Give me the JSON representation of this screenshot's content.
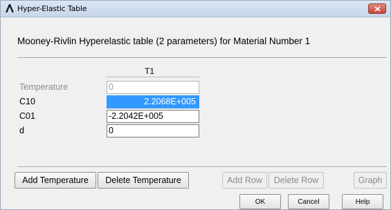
{
  "window": {
    "title": "Hyper-Elastic Table",
    "close_icon": "close-icon",
    "app_icon": "ansys-logo-icon"
  },
  "heading": "Mooney-Rivlin Hyperelastic table (2 parameters) for Material Number 1",
  "table": {
    "column_header": "T1",
    "rows": [
      {
        "label": "Temperature",
        "value": "0",
        "state": "disabled"
      },
      {
        "label": "C10",
        "value": "2.2068E+005",
        "state": "selected"
      },
      {
        "label": "C01",
        "value": "-2.2042E+005",
        "state": "normal"
      },
      {
        "label": "d",
        "value": "0",
        "state": "normal"
      }
    ]
  },
  "buttons": {
    "add_temperature": "Add Temperature",
    "delete_temperature": "Delete Temperature",
    "add_row": "Add Row",
    "delete_row": "Delete Row",
    "graph": "Graph",
    "ok": "OK",
    "cancel": "Cancel",
    "help": "Help"
  },
  "colors": {
    "selection": "#3399ff",
    "titlebar": "#c7d6ea",
    "close_button": "#c7453a"
  }
}
